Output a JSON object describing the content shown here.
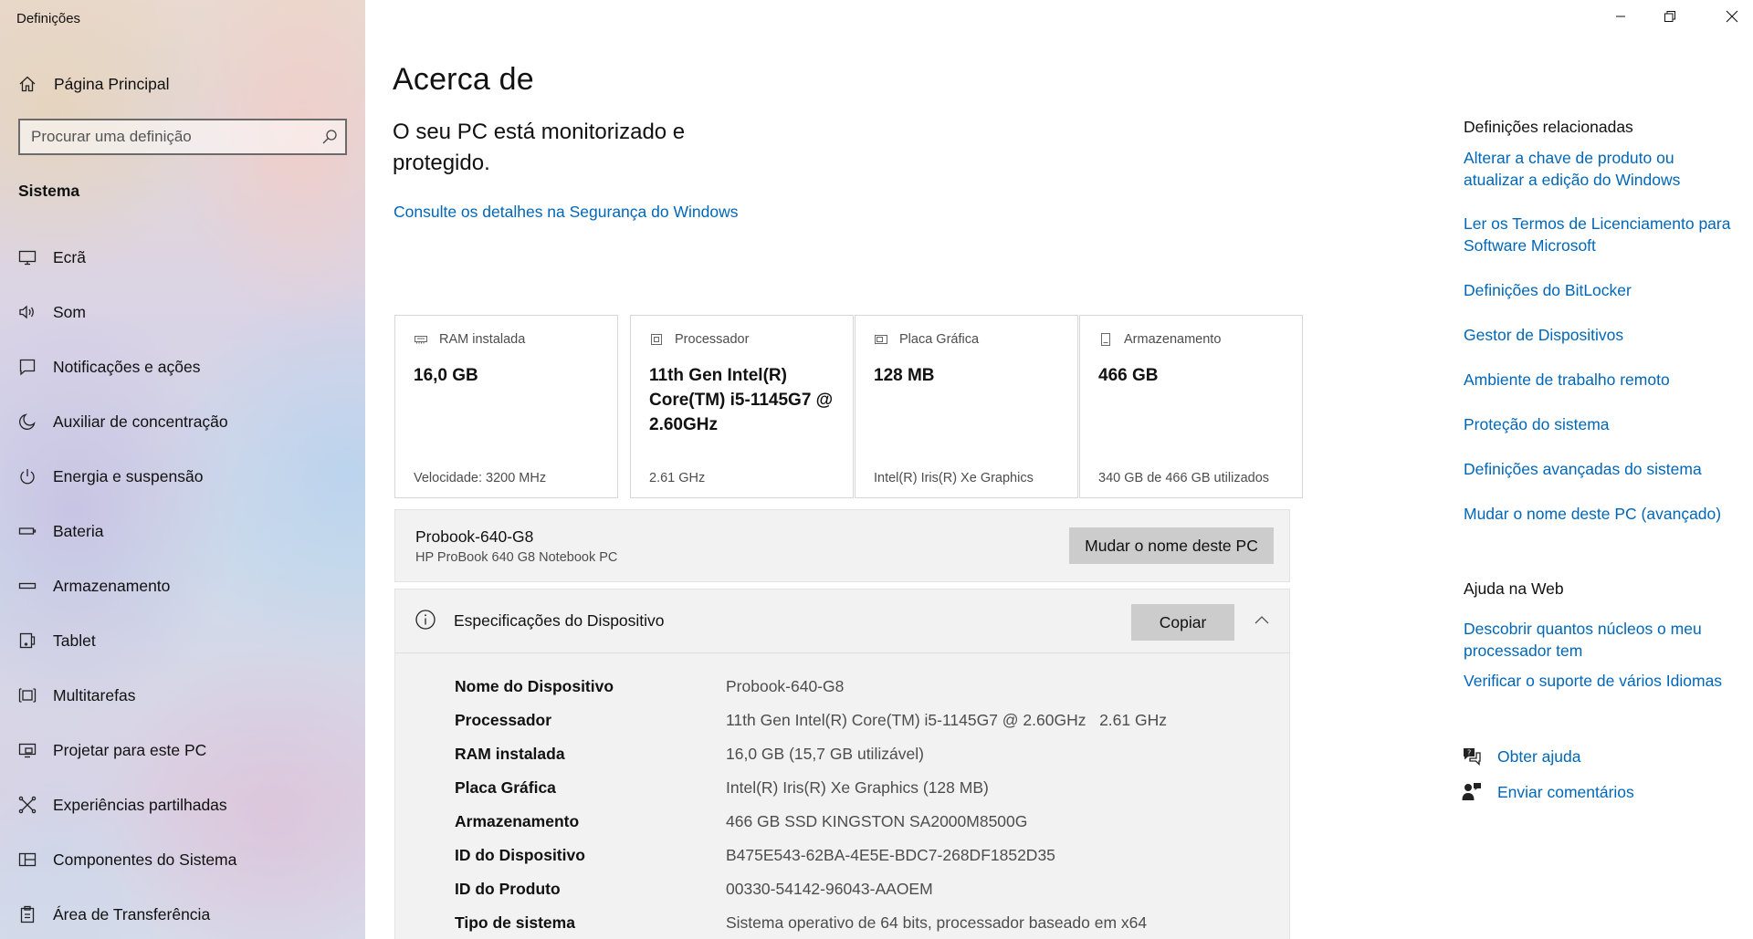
{
  "app": {
    "title": "Definições"
  },
  "sidebar": {
    "home_label": "Página Principal",
    "search_placeholder": "Procurar uma definição",
    "section_title": "Sistema",
    "items": [
      {
        "label": "Ecrã",
        "icon": "monitor-icon"
      },
      {
        "label": "Som",
        "icon": "speaker-icon"
      },
      {
        "label": "Notificações e ações",
        "icon": "notification-icon"
      },
      {
        "label": "Auxiliar de concentração",
        "icon": "moon-icon"
      },
      {
        "label": "Energia e suspensão",
        "icon": "power-icon"
      },
      {
        "label": "Bateria",
        "icon": "battery-icon"
      },
      {
        "label": "Armazenamento",
        "icon": "storage-icon"
      },
      {
        "label": "Tablet",
        "icon": "tablet-icon"
      },
      {
        "label": "Multitarefas",
        "icon": "multitask-icon"
      },
      {
        "label": "Projetar para este PC",
        "icon": "project-icon"
      },
      {
        "label": "Experiências partilhadas",
        "icon": "share-icon"
      },
      {
        "label": "Componentes do Sistema",
        "icon": "components-icon"
      },
      {
        "label": "Área de Transferência",
        "icon": "clipboard-icon"
      }
    ]
  },
  "main": {
    "title": "Acerca de",
    "protection_text": "O seu PC está monitorizado e protegido.",
    "security_link": "Consulte os detalhes na Segurança do Windows",
    "cards": [
      {
        "label": "RAM instalada",
        "value": "16,0 GB",
        "sub": "Velocidade: 3200 MHz",
        "icon": "ram-icon"
      },
      {
        "label": "Processador",
        "value": "11th Gen Intel(R) Core(TM) i5-1145G7 @ 2.60GHz",
        "sub": "2.61 GHz",
        "icon": "processor-icon"
      },
      {
        "label": "Placa Gráfica",
        "value": "128 MB",
        "sub": "Intel(R) Iris(R) Xe Graphics",
        "icon": "gpu-icon"
      },
      {
        "label": "Armazenamento",
        "value": "466 GB",
        "sub": "340 GB de 466 GB utilizados",
        "icon": "disk-icon"
      }
    ],
    "pc": {
      "name": "Probook-640-G8",
      "model": "HP ProBook 640 G8 Notebook PC",
      "rename_button": "Mudar o nome deste PC"
    },
    "specs": {
      "title": "Especificações do Dispositivo",
      "copy_button": "Copiar",
      "rows": [
        {
          "label": "Nome do Dispositivo",
          "value": "Probook-640-G8"
        },
        {
          "label": "Processador",
          "value": "11th Gen Intel(R) Core(TM) i5-1145G7 @ 2.60GHz   2.61 GHz"
        },
        {
          "label": "RAM instalada",
          "value": "16,0 GB (15,7 GB utilizável)"
        },
        {
          "label": "Placa Gráfica",
          "value": "Intel(R) Iris(R) Xe Graphics (128 MB)"
        },
        {
          "label": "Armazenamento",
          "value": "466 GB SSD KINGSTON SA2000M8500G"
        },
        {
          "label": "ID do Dispositivo",
          "value": "B475E543-62BA-4E5E-BDC7-268DF1852D35"
        },
        {
          "label": "ID do Produto",
          "value": "00330-54142-96043-AAOEM"
        },
        {
          "label": "Tipo de sistema",
          "value": "Sistema operativo de 64 bits, processador baseado em x64"
        }
      ]
    }
  },
  "related": {
    "heading": "Definições relacionadas",
    "links": [
      "Alterar a chave de produto ou atualizar a edição do Windows",
      "Ler os Termos de Licenciamento para Software Microsoft",
      "Definições do BitLocker",
      "Gestor de Dispositivos",
      "Ambiente de trabalho remoto",
      "Proteção do sistema",
      "Definições avançadas do sistema",
      "Mudar o nome deste PC (avançado)"
    ]
  },
  "web_help": {
    "heading": "Ajuda na Web",
    "links": [
      "Descobrir quantos núcleos o meu processador tem",
      "Verificar o suporte de vários Idiomas"
    ]
  },
  "support": {
    "get_help": "Obter ajuda",
    "send_feedback": "Enviar comentários"
  },
  "colors": {
    "link": "#0067b8",
    "button": "#cccccc",
    "panel": "#f2f2f2"
  }
}
